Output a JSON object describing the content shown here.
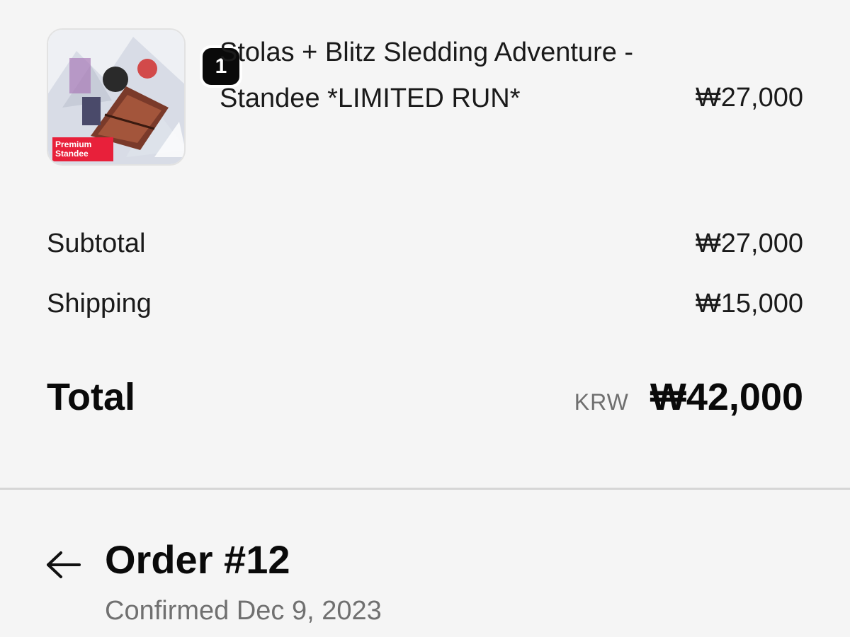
{
  "line_item": {
    "quantity": "1",
    "name": "Stolas + Blitz Sledding Adventure - Standee *LIMITED RUN*",
    "price": "₩27,000",
    "thumbnail_tag": "Premium\nStandee",
    "thumbnail_icon": "product-image"
  },
  "summary": {
    "subtotal_label": "Subtotal",
    "subtotal_value": "₩27,000",
    "shipping_label": "Shipping",
    "shipping_value": "₩15,000",
    "total_label": "Total",
    "currency": "KRW",
    "total_value": "₩42,000"
  },
  "order": {
    "back_icon": "arrow-left-icon",
    "title": "Order #12",
    "status": "Confirmed Dec 9, 2023"
  },
  "colors": {
    "background": "#f5f5f5",
    "badge": "#0a0a0a",
    "tag": "#e8203a",
    "muted_text": "#707070"
  }
}
